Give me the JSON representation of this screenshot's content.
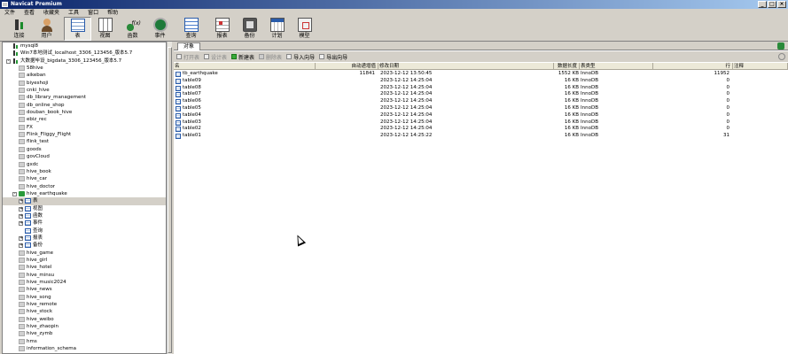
{
  "window": {
    "title": "Navicat Premium"
  },
  "menu": [
    "文件",
    "查看",
    "收藏夹",
    "工具",
    "窗口",
    "帮助"
  ],
  "toolbar": [
    {
      "label": "连接",
      "icon": "connection-icon"
    },
    {
      "label": "用户",
      "icon": "user-icon"
    },
    {
      "label": "表",
      "icon": "table-icon",
      "active": true
    },
    {
      "label": "视图",
      "icon": "view-icon"
    },
    {
      "label": "函数",
      "icon": "function-icon"
    },
    {
      "label": "事件",
      "icon": "event-icon"
    },
    {
      "label": "查询",
      "icon": "query-icon"
    },
    {
      "label": "报表",
      "icon": "report-icon"
    },
    {
      "label": "备份",
      "icon": "backup-icon"
    },
    {
      "label": "计划",
      "icon": "schedule-icon"
    },
    {
      "label": "模型",
      "icon": "model-icon"
    }
  ],
  "tree": [
    {
      "label": "mysql8",
      "level": 0,
      "icon": "conn"
    },
    {
      "label": "Win7本地测试_localhost_3306_123456_版本5.7",
      "level": 0,
      "icon": "conn"
    },
    {
      "label": "大数据毕设_bigdata_3306_123456_版本5.7",
      "level": 0,
      "icon": "conn",
      "exp": "-"
    },
    {
      "label": "58hive",
      "level": 1,
      "icon": "db"
    },
    {
      "label": "aikeban",
      "level": 1,
      "icon": "db"
    },
    {
      "label": "biyeshoji",
      "level": 1,
      "icon": "db"
    },
    {
      "label": "cnki_hive",
      "level": 1,
      "icon": "db"
    },
    {
      "label": "db_library_management",
      "level": 1,
      "icon": "db"
    },
    {
      "label": "db_online_shop",
      "level": 1,
      "icon": "db"
    },
    {
      "label": "douban_book_hive",
      "level": 1,
      "icon": "db"
    },
    {
      "label": "ebiz_rec",
      "level": 1,
      "icon": "db"
    },
    {
      "label": "FX",
      "level": 1,
      "icon": "db"
    },
    {
      "label": "Flink_Fliggy_Flight",
      "level": 1,
      "icon": "db"
    },
    {
      "label": "flink_test",
      "level": 1,
      "icon": "db"
    },
    {
      "label": "goods",
      "level": 1,
      "icon": "db"
    },
    {
      "label": "govCloud",
      "level": 1,
      "icon": "db"
    },
    {
      "label": "gxdc",
      "level": 1,
      "icon": "db"
    },
    {
      "label": "hive_book",
      "level": 1,
      "icon": "db"
    },
    {
      "label": "hive_car",
      "level": 1,
      "icon": "db"
    },
    {
      "label": "hive_doctor",
      "level": 1,
      "icon": "db"
    },
    {
      "label": "hive_earthquake",
      "level": 1,
      "icon": "db-open",
      "exp": "-"
    },
    {
      "label": "表",
      "level": 2,
      "icon": "sub",
      "exp": "+",
      "selected": true
    },
    {
      "label": "视图",
      "level": 2,
      "icon": "sub",
      "exp": "+"
    },
    {
      "label": "函数",
      "level": 2,
      "icon": "sub",
      "exp": "+"
    },
    {
      "label": "事件",
      "level": 2,
      "icon": "sub",
      "exp": "+"
    },
    {
      "label": "查询",
      "level": 2,
      "icon": "sub"
    },
    {
      "label": "报表",
      "level": 2,
      "icon": "sub",
      "exp": "+"
    },
    {
      "label": "备份",
      "level": 2,
      "icon": "sub",
      "exp": "+"
    },
    {
      "label": "hive_game",
      "level": 1,
      "icon": "db"
    },
    {
      "label": "hive_girl",
      "level": 1,
      "icon": "db"
    },
    {
      "label": "hive_hotel",
      "level": 1,
      "icon": "db"
    },
    {
      "label": "hive_minsu",
      "level": 1,
      "icon": "db"
    },
    {
      "label": "hive_music2024",
      "level": 1,
      "icon": "db"
    },
    {
      "label": "hive_news",
      "level": 1,
      "icon": "db"
    },
    {
      "label": "hive_song",
      "level": 1,
      "icon": "db"
    },
    {
      "label": "hive_remote",
      "level": 1,
      "icon": "db"
    },
    {
      "label": "hive_stock",
      "level": 1,
      "icon": "db"
    },
    {
      "label": "hive_weibo",
      "level": 1,
      "icon": "db"
    },
    {
      "label": "hive_zhaopin",
      "level": 1,
      "icon": "db"
    },
    {
      "label": "hive_zymb",
      "level": 1,
      "icon": "db"
    },
    {
      "label": "hms",
      "level": 1,
      "icon": "db"
    },
    {
      "label": "information_schema",
      "level": 1,
      "icon": "db"
    }
  ],
  "tabs": [
    {
      "label": "对象"
    }
  ],
  "object_toolbar": [
    {
      "label": "打开表",
      "disabled": true,
      "icon": "open-table-icon"
    },
    {
      "label": "设计表",
      "disabled": true,
      "icon": "design-table-icon"
    },
    {
      "label": "新建表",
      "disabled": false,
      "icon": "new-table-icon",
      "color": "green"
    },
    {
      "label": "删除表",
      "disabled": true,
      "icon": "delete-table-icon",
      "color": "red"
    },
    {
      "label": "导入向导",
      "disabled": false,
      "icon": "import-icon"
    },
    {
      "label": "导出向导",
      "disabled": false,
      "icon": "export-icon"
    }
  ],
  "table": {
    "columns": [
      "名",
      "自动递增值",
      "修改日期",
      "数据长度",
      "表类型",
      "行",
      "注释"
    ],
    "rows": [
      [
        "tb_earthquake",
        "11841",
        "2023-12-12 13:50:45",
        "1552 KB",
        "InnoDB",
        "11952",
        ""
      ],
      [
        "table09",
        "",
        "2023-12-12 14:25:04",
        "16 KB",
        "InnoDB",
        "0",
        ""
      ],
      [
        "table08",
        "",
        "2023-12-12 14:25:04",
        "16 KB",
        "InnoDB",
        "0",
        ""
      ],
      [
        "table07",
        "",
        "2023-12-12 14:25:04",
        "16 KB",
        "InnoDB",
        "0",
        ""
      ],
      [
        "table06",
        "",
        "2023-12-12 14:25:04",
        "16 KB",
        "InnoDB",
        "0",
        ""
      ],
      [
        "table05",
        "",
        "2023-12-12 14:25:04",
        "16 KB",
        "InnoDB",
        "0",
        ""
      ],
      [
        "table04",
        "",
        "2023-12-12 14:25:04",
        "16 KB",
        "InnoDB",
        "0",
        ""
      ],
      [
        "table03",
        "",
        "2023-12-12 14:25:04",
        "16 KB",
        "InnoDB",
        "0",
        ""
      ],
      [
        "table02",
        "",
        "2023-12-12 14:25:04",
        "16 KB",
        "InnoDB",
        "0",
        ""
      ],
      [
        "table01",
        "",
        "2023-12-12 14:25:22",
        "16 KB",
        "InnoDB",
        "31",
        ""
      ]
    ]
  }
}
